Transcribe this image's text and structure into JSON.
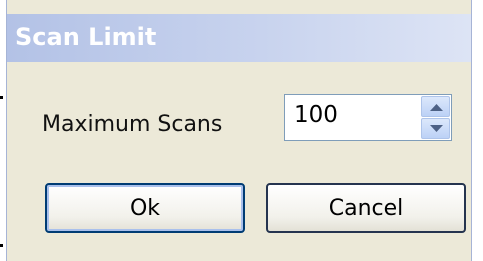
{
  "dialog": {
    "title": "Scan Limit",
    "label": "Maximum Scans",
    "spinner": {
      "value": "100"
    },
    "buttons": {
      "ok": "Ok",
      "cancel": "Cancel"
    }
  }
}
